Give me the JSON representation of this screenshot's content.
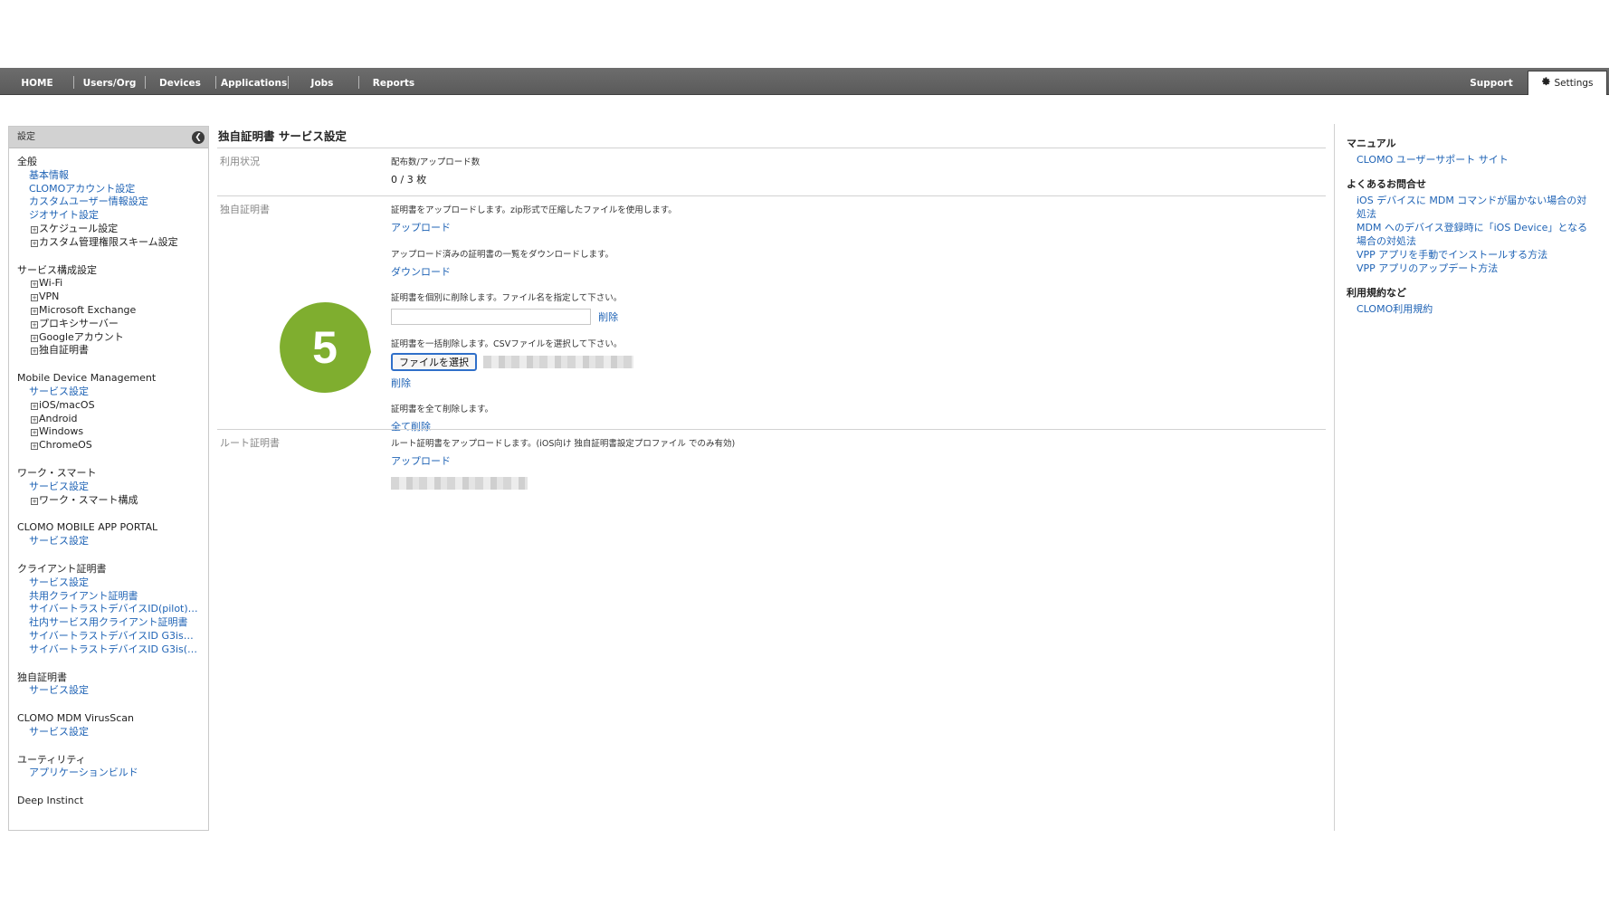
{
  "nav": {
    "items": [
      "HOME",
      "Users/Org",
      "Devices",
      "Applications",
      "Jobs",
      "Reports"
    ],
    "support": "Support",
    "settings": "Settings"
  },
  "sidebar": {
    "header": "設定",
    "groups": [
      {
        "title": "全般",
        "items": [
          {
            "label": "基本情報",
            "type": "link"
          },
          {
            "label": "CLOMOアカウント設定",
            "type": "link"
          },
          {
            "label": "カスタムユーザー情報設定",
            "type": "link"
          },
          {
            "label": "ジオサイト設定",
            "type": "link"
          },
          {
            "label": "スケジュール設定",
            "type": "sub"
          },
          {
            "label": "カスタム管理権限スキーム設定",
            "type": "sub"
          }
        ]
      },
      {
        "title": "サービス構成設定",
        "items": [
          {
            "label": "Wi-Fi",
            "type": "sub"
          },
          {
            "label": "VPN",
            "type": "sub"
          },
          {
            "label": "Microsoft Exchange",
            "type": "sub"
          },
          {
            "label": "プロキシサーバー",
            "type": "sub"
          },
          {
            "label": "Googleアカウント",
            "type": "sub"
          },
          {
            "label": "独自証明書",
            "type": "sub"
          }
        ]
      },
      {
        "title": "Mobile Device Management",
        "items": [
          {
            "label": "サービス設定",
            "type": "link"
          },
          {
            "label": "iOS/macOS",
            "type": "sub"
          },
          {
            "label": "Android",
            "type": "sub"
          },
          {
            "label": "Windows",
            "type": "sub"
          },
          {
            "label": "ChromeOS",
            "type": "sub"
          }
        ]
      },
      {
        "title": "ワーク・スマート",
        "items": [
          {
            "label": "サービス設定",
            "type": "link"
          },
          {
            "label": "ワーク・スマート構成",
            "type": "sub"
          }
        ]
      },
      {
        "title": "CLOMO MOBILE APP PORTAL",
        "items": [
          {
            "label": "サービス設定",
            "type": "link"
          }
        ]
      },
      {
        "title": "クライアント証明書",
        "items": [
          {
            "label": "サービス設定",
            "type": "link"
          },
          {
            "label": "共用クライアント証明書",
            "type": "link"
          },
          {
            "label": "サイバートラストデバイスID(pilot)…",
            "type": "link"
          },
          {
            "label": "社内サービス用クライアント証明書",
            "type": "link"
          },
          {
            "label": "サイバートラストデバイスID G3is…",
            "type": "link"
          },
          {
            "label": "サイバートラストデバイスID G3is(…",
            "type": "link"
          }
        ]
      },
      {
        "title": "独自証明書",
        "items": [
          {
            "label": "サービス設定",
            "type": "link"
          }
        ]
      },
      {
        "title": "CLOMO MDM VirusScan",
        "items": [
          {
            "label": "サービス設定",
            "type": "link"
          }
        ]
      },
      {
        "title": "ユーティリティ",
        "items": [
          {
            "label": "アプリケーションビルド",
            "type": "link"
          }
        ]
      },
      {
        "title": "Deep Instinct",
        "items": []
      }
    ]
  },
  "main": {
    "title": "独自証明書 サービス設定",
    "usage": {
      "label": "利用状況",
      "caption": "配布数/アップロード数",
      "value": "0 / 3 枚"
    },
    "cert": {
      "label": "独自証明書",
      "upload_desc": "証明書をアップロードします。zip形式で圧縮したファイルを使用します。",
      "upload_link": "アップロード",
      "download_desc": "アップロード済みの証明書の一覧をダウンロードします。",
      "download_link": "ダウンロード",
      "delete_one_desc": "証明書を個別に削除します。ファイル名を指定して下さい。",
      "delete_one_link": "削除",
      "bulk_desc": "証明書を一括削除します。CSVファイルを選択して下さい。",
      "file_button": "ファイルを選択",
      "bulk_delete_link": "削除",
      "delete_all_desc": "証明書を全て削除します。",
      "delete_all_link": "全て削除"
    },
    "root": {
      "label": "ルート証明書",
      "desc": "ルート証明書をアップロードします。(iOS向け 独自証明書設定プロファイル でのみ有効)",
      "upload_link": "アップロード"
    },
    "step_badge": "5",
    "badge_color": "#7fae2f"
  },
  "right": {
    "sections": [
      {
        "heading": "マニュアル",
        "links": [
          "CLOMO ユーザーサポート サイト"
        ]
      },
      {
        "heading": "よくあるお問合せ",
        "links": [
          "iOS デバイスに MDM コマンドが届かない場合の対処法",
          "MDM へのデバイス登録時に「iOS Device」となる場合の対処法",
          "VPP アプリを手動でインストールする方法",
          "VPP アプリのアップデート方法"
        ]
      },
      {
        "heading": "利用規約など",
        "links": [
          "CLOMO利用規約"
        ]
      }
    ]
  },
  "colors": {
    "nav_bg": "#5f5f5f",
    "link": "#1f63b5"
  }
}
